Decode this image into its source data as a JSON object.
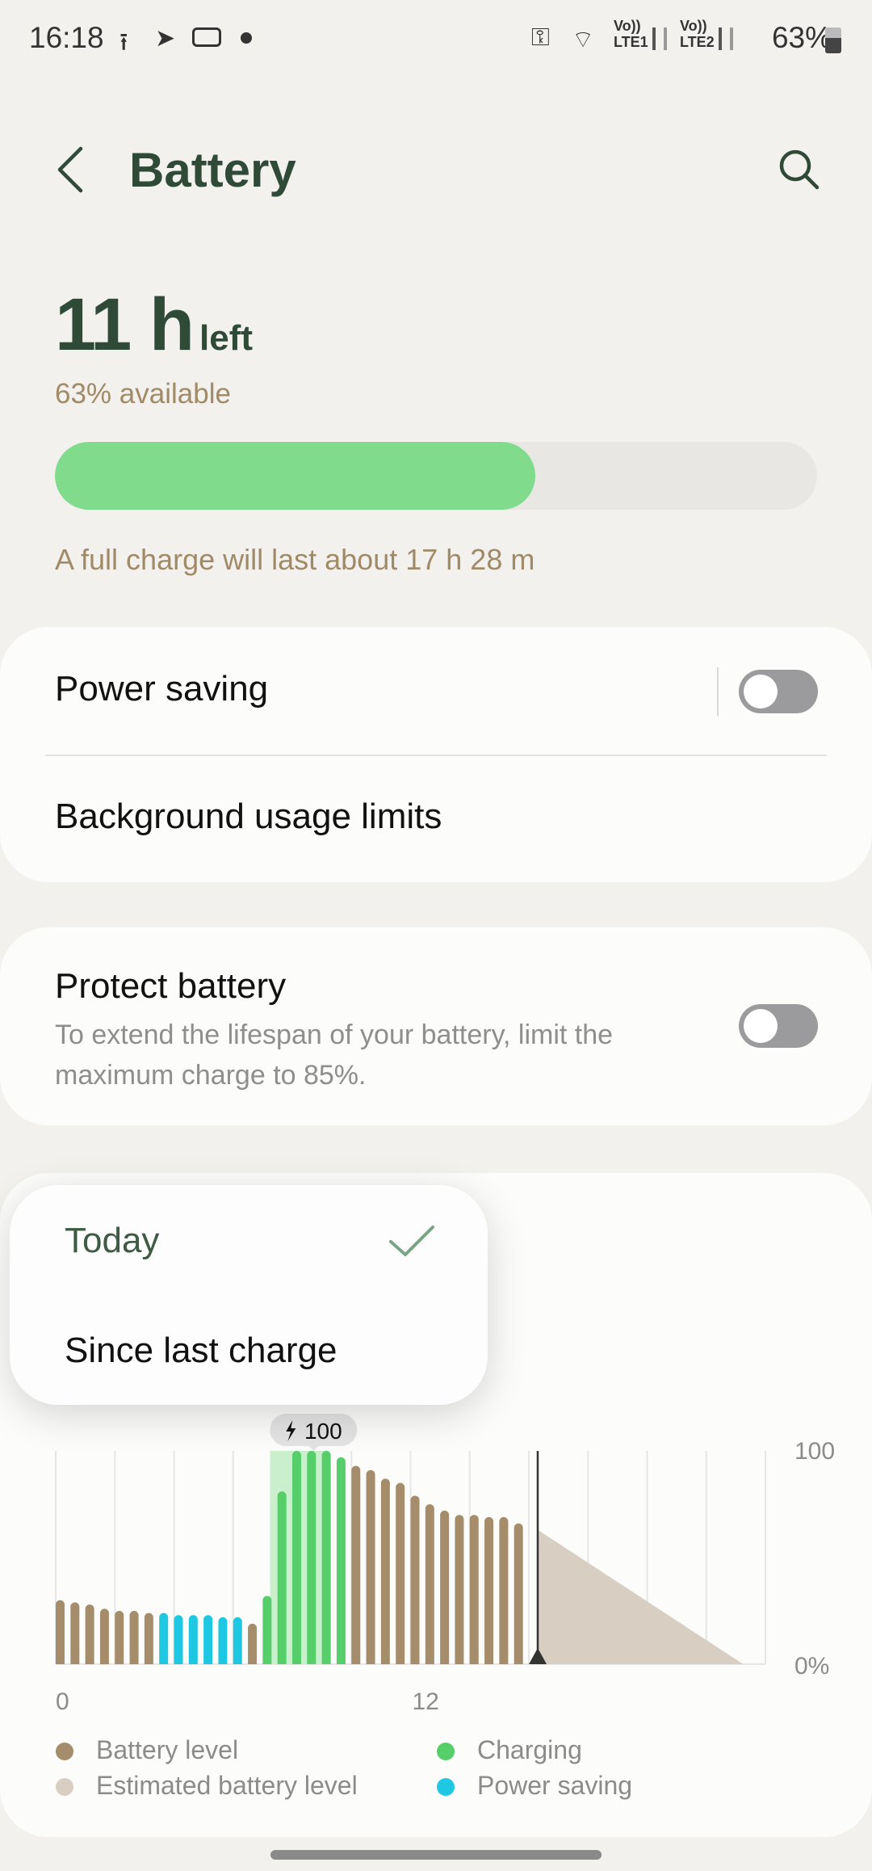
{
  "status_bar": {
    "time": "16:18",
    "left_icons": [
      "upload-icon",
      "telegram-icon",
      "vpn-pill-icon",
      "notification-dot-icon"
    ],
    "right_icons": [
      "vpn-key-icon",
      "wifi-icon",
      "volte-lte1-signal-icon",
      "volte-lte2-signal-icon",
      "battery-icon"
    ],
    "lte1": "LTE1",
    "lte2": "LTE2",
    "volte": "Vo))",
    "battery_percent": "63%"
  },
  "header": {
    "title": "Battery",
    "back_icon": "back-arrow-icon",
    "search_icon": "search-icon"
  },
  "summary": {
    "time_left_value": "11 h",
    "time_left_suffix": "left",
    "available": "63% available",
    "level_percent": 63,
    "full_charge": "A full charge will last about 17 h 28 m"
  },
  "settings": {
    "power_saving": {
      "label": "Power saving",
      "enabled": false
    },
    "background_limits": {
      "label": "Background usage limits"
    },
    "protect_battery": {
      "label": "Protect battery",
      "description": "To extend the lifespan of your battery, limit the maximum charge to 85%.",
      "enabled": false
    }
  },
  "period_menu": {
    "options": [
      {
        "label": "Today",
        "selected": true
      },
      {
        "label": "Since last charge",
        "selected": false
      }
    ]
  },
  "colors": {
    "accent": "#2f4a36",
    "battery_level": "#a58d6b",
    "estimated": "#d8cec1",
    "charging": "#56cf6a",
    "power_saving": "#1ec8e3"
  },
  "chart_data": {
    "type": "bar",
    "x_unit": "hour",
    "xlim": [
      0,
      24
    ],
    "ylim": [
      0,
      100
    ],
    "x_tick_labels": [
      "0",
      "12"
    ],
    "y_tick_labels": [
      "100",
      "0%"
    ],
    "grid": true,
    "callout": "100",
    "current_time": 16.3,
    "bar_interval_hours": 0.5,
    "values": [
      30,
      29,
      28,
      26,
      25,
      25,
      24,
      24,
      23,
      23,
      23,
      22,
      22,
      19,
      32,
      81,
      100,
      100,
      100,
      97,
      93,
      91,
      87,
      85,
      79,
      75,
      72,
      70,
      70,
      69,
      69,
      66
    ],
    "states": [
      "battery",
      "battery",
      "battery",
      "battery",
      "battery",
      "battery",
      "battery",
      "power_saving",
      "power_saving",
      "power_saving",
      "power_saving",
      "power_saving",
      "power_saving",
      "battery",
      "charging",
      "charging",
      "charging",
      "charging",
      "charging",
      "charging",
      "battery",
      "battery",
      "battery",
      "battery",
      "battery",
      "battery",
      "battery",
      "battery",
      "battery",
      "battery",
      "battery",
      "battery"
    ],
    "charging_window": [
      7.25,
      9.25
    ],
    "estimated": {
      "x": [
        16.3,
        23.25
      ],
      "y": [
        63,
        0
      ]
    },
    "legend": [
      {
        "label": "Battery level",
        "key": "battery_level"
      },
      {
        "label": "Charging",
        "key": "charging"
      },
      {
        "label": "Estimated battery level",
        "key": "estimated"
      },
      {
        "label": "Power saving",
        "key": "power_saving"
      }
    ],
    "legend_placement": "bottom"
  }
}
